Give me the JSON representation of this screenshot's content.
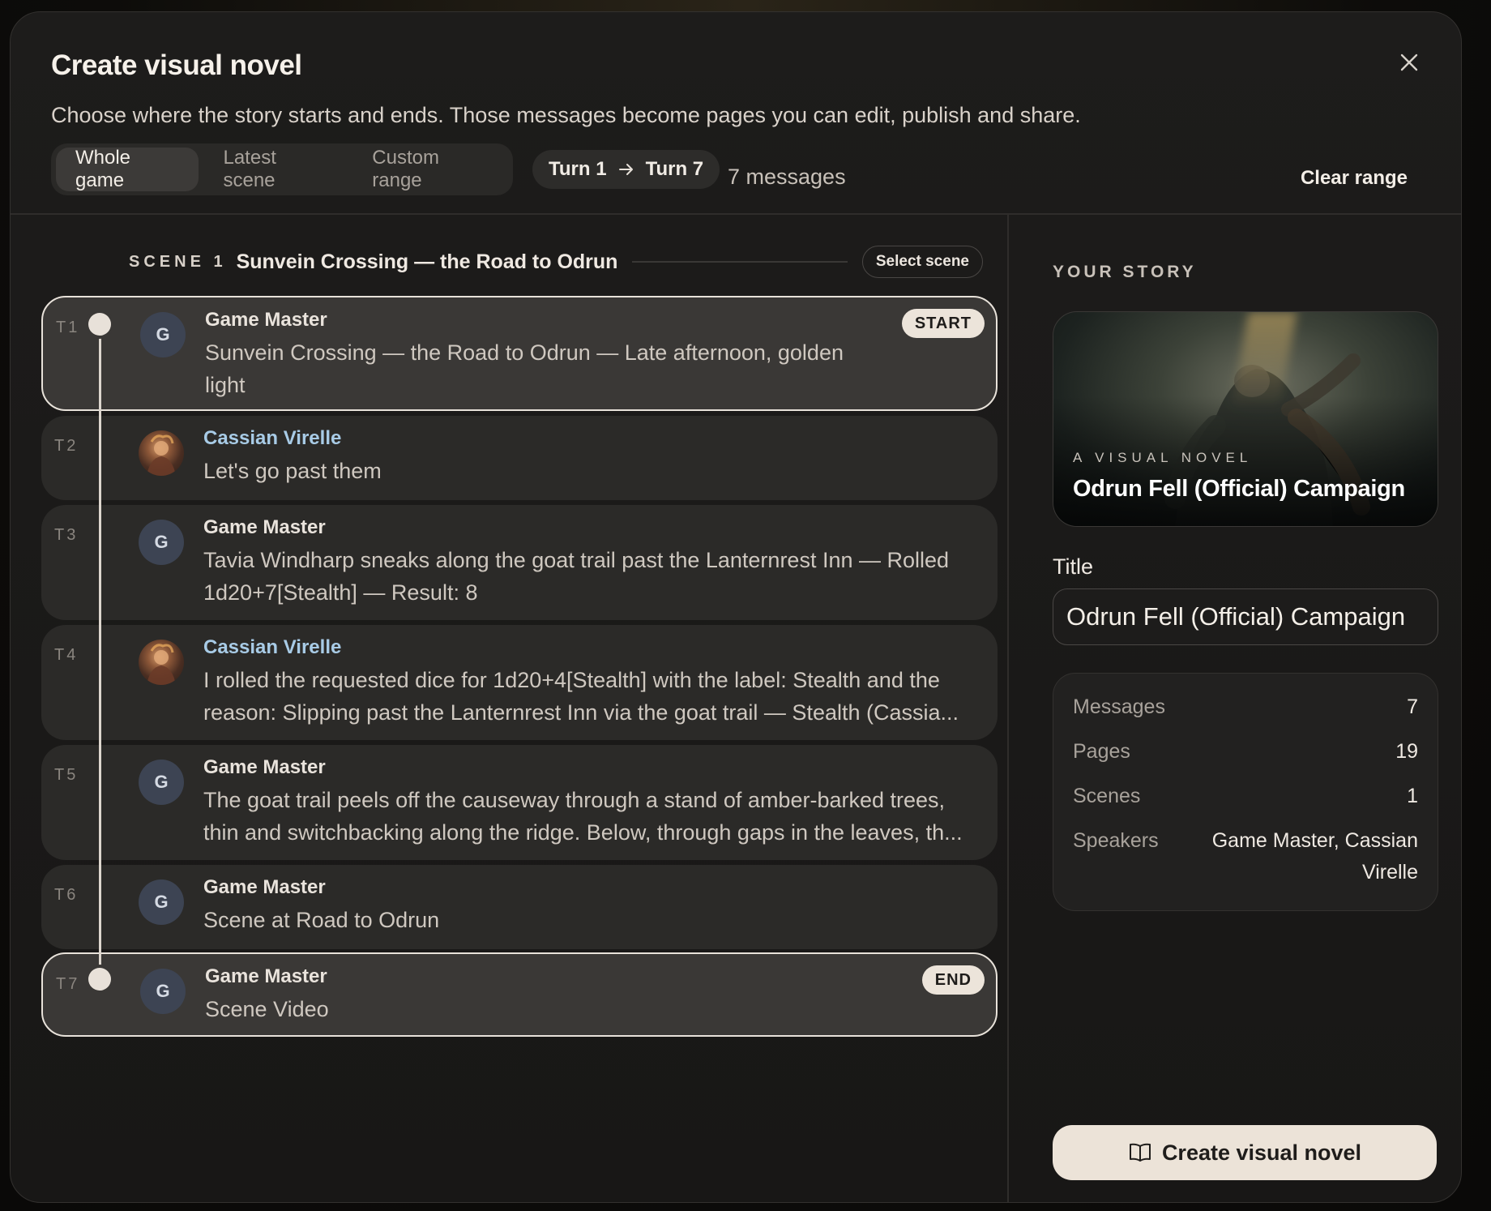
{
  "dialog": {
    "title": "Create visual novel",
    "subtitle": "Choose where the story starts and ends. Those messages become pages you can edit, publish and share.",
    "close_icon": "close-icon"
  },
  "range_modes": [
    {
      "label": "Whole game",
      "active": true
    },
    {
      "label": "Latest scene",
      "active": false
    },
    {
      "label": "Custom range",
      "active": false
    }
  ],
  "range": {
    "start_label": "Turn 1",
    "end_label": "Turn 7",
    "arrow_icon": "arrow-right-icon",
    "message_count": "7 messages",
    "clear_label": "Clear range"
  },
  "scene": {
    "tag": "SCENE 1",
    "name": "Sunvein Crossing — the Road to Odrun",
    "select_label": "Select scene"
  },
  "turns": [
    {
      "label": "T1",
      "speaker": "Game Master",
      "avatar_letter": "G",
      "text": "Sunvein Crossing — the Road to Odrun — Late afternoon, golden light",
      "badge": "START"
    },
    {
      "label": "T2",
      "speaker": "Cassian Virelle",
      "avatar_letter": "",
      "text": "Let's go past them",
      "badge": ""
    },
    {
      "label": "T3",
      "speaker": "Game Master",
      "avatar_letter": "G",
      "text": "Tavia Windharp sneaks along the goat trail past the Lanternrest Inn — Rolled 1d20+7[Stealth] — Result: 8",
      "badge": ""
    },
    {
      "label": "T4",
      "speaker": "Cassian Virelle",
      "avatar_letter": "",
      "text": "I rolled the requested dice for 1d20+4[Stealth] with the label: Stealth and the reason: Slipping past the Lanternrest Inn via the goat trail — Stealth (Cassia...",
      "badge": ""
    },
    {
      "label": "T5",
      "speaker": "Game Master",
      "avatar_letter": "G",
      "text": "The goat trail peels off the causeway through a stand of amber-barked trees, thin and switchbacking along the ridge. Below, through gaps in the leaves, th...",
      "badge": ""
    },
    {
      "label": "T6",
      "speaker": "Game Master",
      "avatar_letter": "G",
      "text": "Scene at Road to Odrun",
      "badge": ""
    },
    {
      "label": "T7",
      "speaker": "Game Master",
      "avatar_letter": "G",
      "text": "Scene Video",
      "badge": "END"
    }
  ],
  "story": {
    "heading": "YOUR STORY",
    "cover_kicker": "A VISUAL NOVEL",
    "cover_title": "Odrun Fell (Official) Campaign",
    "title_label": "Title",
    "title_value": "Odrun Fell (Official) Campaign",
    "stats": [
      {
        "key": "Messages",
        "value": "7"
      },
      {
        "key": "Pages",
        "value": "19"
      },
      {
        "key": "Scenes",
        "value": "1"
      },
      {
        "key": "Speakers",
        "value": "Game Master, Cassian Virelle"
      }
    ],
    "create_label": "Create visual novel",
    "create_icon": "book-open-icon"
  }
}
